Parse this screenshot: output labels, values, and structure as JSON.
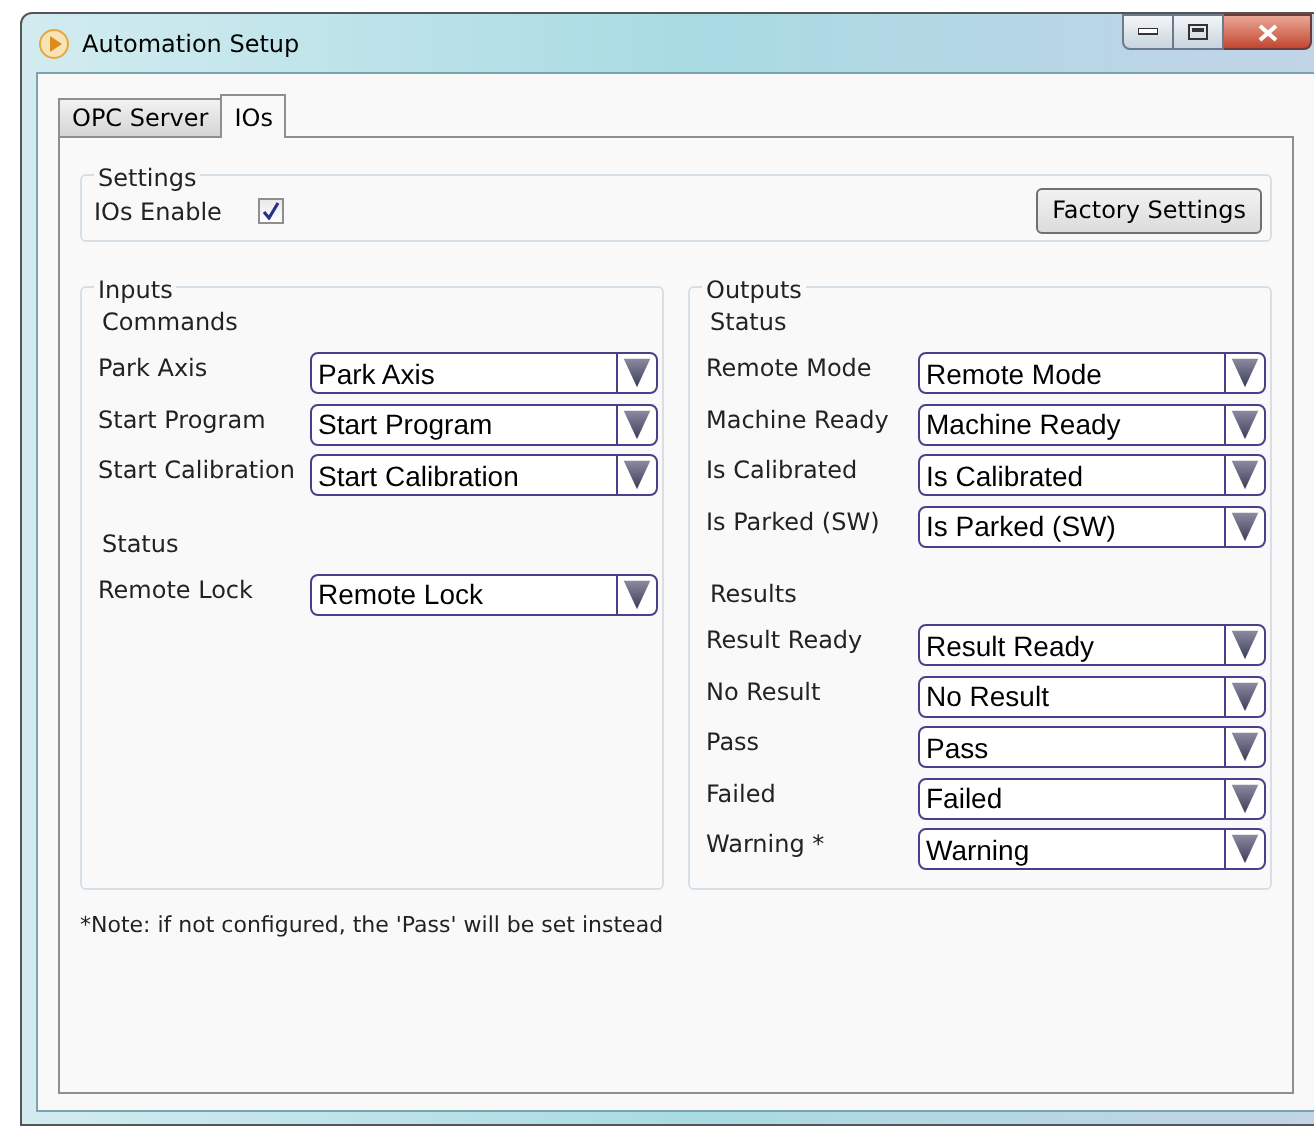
{
  "window": {
    "title": "Automation Setup"
  },
  "tabs": [
    {
      "label": "OPC Server",
      "selected": false
    },
    {
      "label": "IOs",
      "selected": true
    }
  ],
  "settings": {
    "title": "Settings",
    "enable_label": "IOs Enable",
    "enable_checked": true,
    "factory_button": "Factory Settings"
  },
  "groups": [
    {
      "title": "Inputs",
      "sections": [
        {
          "title": "Commands",
          "rows": [
            {
              "label": "Park Axis",
              "value": "Park Axis"
            },
            {
              "label": "Start Program",
              "value": "Start Program"
            },
            {
              "label": "Start Calibration",
              "value": "Start Calibration"
            }
          ]
        },
        {
          "title": "Status",
          "rows": [
            {
              "label": "Remote Lock",
              "value": "Remote Lock"
            }
          ]
        }
      ]
    },
    {
      "title": "Outputs",
      "sections": [
        {
          "title": "Status",
          "rows": [
            {
              "label": "Remote Mode",
              "value": "Remote Mode"
            },
            {
              "label": "Machine Ready",
              "value": "Machine Ready"
            },
            {
              "label": "Is Calibrated",
              "value": "Is Calibrated"
            },
            {
              "label": "Is Parked (SW)",
              "value": "Is Parked (SW)"
            }
          ]
        },
        {
          "title": "Results",
          "rows": [
            {
              "label": "Result Ready",
              "value": "Result Ready"
            },
            {
              "label": "No Result",
              "value": "No Result"
            },
            {
              "label": "Pass",
              "value": "Pass"
            },
            {
              "label": "Failed",
              "value": "Failed"
            },
            {
              "label": "Warning *",
              "value": "Warning"
            }
          ]
        }
      ]
    }
  ],
  "note": "*Note: if not configured, the 'Pass' will be set instead"
}
